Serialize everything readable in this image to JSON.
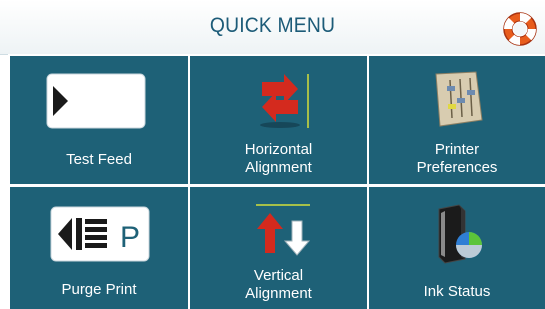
{
  "header": {
    "title": "QUICK MENU",
    "help_icon": "lifebuoy-icon"
  },
  "menu": {
    "items": [
      {
        "label": "Test Feed",
        "icon": "test-feed-icon"
      },
      {
        "label_line1": "Horizontal",
        "label_line2": "Alignment",
        "icon": "horizontal-alignment-arrows-icon"
      },
      {
        "label_line1": "Printer",
        "label_line2": "Preferences",
        "icon": "printer-preferences-sliders-icon"
      },
      {
        "label": "Purge Print",
        "icon": "purge-print-icon",
        "icon_letter": "P"
      },
      {
        "label_line1": "Vertical",
        "label_line2": "Alignment",
        "icon": "vertical-alignment-arrows-icon"
      },
      {
        "label": "Ink Status",
        "icon": "ink-status-cartridge-icon"
      }
    ]
  },
  "colors": {
    "tile_background": "#1e6177",
    "title_text": "#1c5b78",
    "arrow_red": "#d42a1e"
  }
}
